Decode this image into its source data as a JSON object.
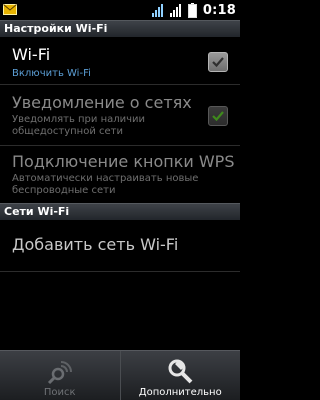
{
  "status_bar": {
    "time": "0:18",
    "icons": [
      "mail-icon",
      "wifi-signal-icon",
      "cell-signal-icon",
      "battery-icon"
    ]
  },
  "header": {
    "title": "Настройки Wi-Fi"
  },
  "prefs": [
    {
      "title": "Wi-Fi",
      "summary": "Включить Wi-Fi",
      "checked": true,
      "enabled": true
    },
    {
      "title": "Уведомление о сетях",
      "summary_line1": "Уведомлять при наличии",
      "summary_line2": "общедоступной сети",
      "checked": true,
      "enabled": false
    },
    {
      "title": "Подключение кнопки WPS",
      "summary_line1": "Автоматически настраивать новые",
      "summary_line2": "беспроводные сети",
      "enabled": false
    }
  ],
  "networks_section": {
    "title": "Сети Wi-Fi",
    "add_label": "Добавить сеть Wi-Fi"
  },
  "bottom_bar": {
    "search_label": "Поиск",
    "more_label": "Дополнительно"
  },
  "colors": {
    "accent_summary": "#5c9fd6",
    "check_green": "#78c82a"
  }
}
